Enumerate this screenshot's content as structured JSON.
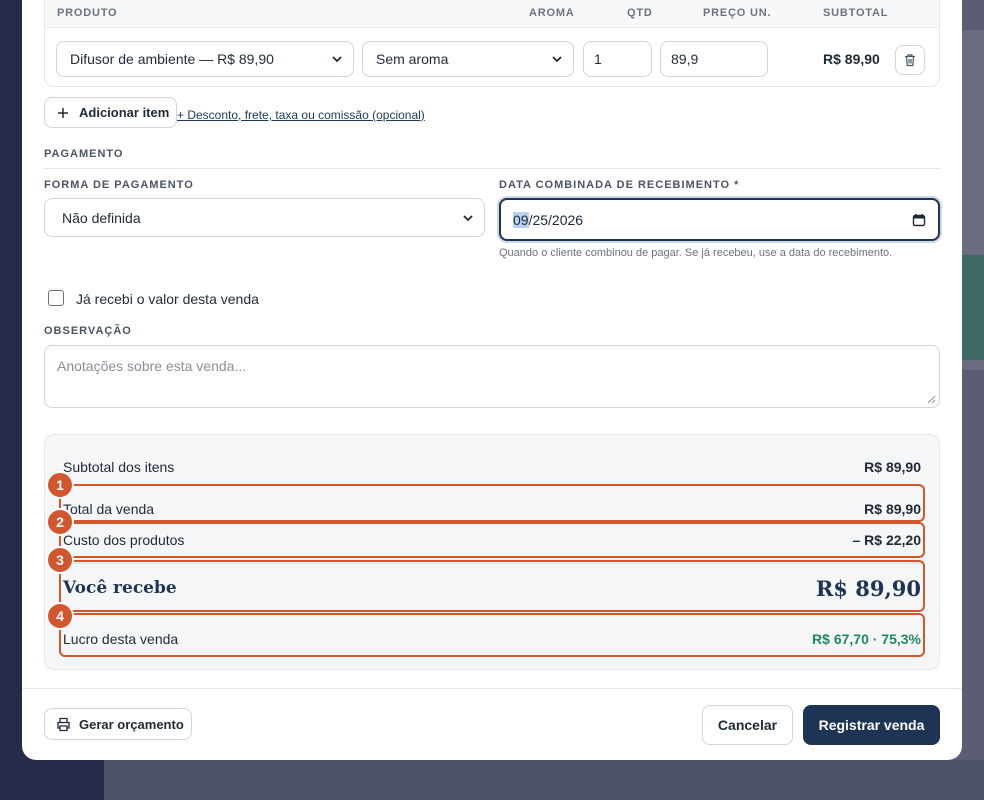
{
  "items_table": {
    "headers": {
      "product": "PRODUTO",
      "aroma": "AROMA",
      "qty": "QTD",
      "unit_price": "PREÇO UN.",
      "subtotal": "SUBTOTAL"
    },
    "row": {
      "product": "Difusor de ambiente — R$ 89,90",
      "aroma": "Sem aroma",
      "qty": "1",
      "unit_price": "89,9",
      "subtotal": "R$ 89,90"
    }
  },
  "actions": {
    "add_item": "Adicionar item",
    "extras_link": "+ Desconto, frete, taxa ou comissão (opcional)"
  },
  "payment": {
    "section": "PAGAMENTO",
    "method_label": "FORMA DE PAGAMENTO",
    "method_value": "Não definida",
    "date_label": "DATA COMBINADA DE RECEBIMENTO *",
    "date_month": "09",
    "date_rest": "/25/2026",
    "date_hint": "Quando o cliente combinou de pagar. Se já recebeu, use a data do recebimento.",
    "received_label": "Já recebi o valor desta venda"
  },
  "note": {
    "label": "OBSERVAÇÃO",
    "placeholder": "Anotações sobre esta venda..."
  },
  "summary": {
    "subtotal_label": "Subtotal dos itens",
    "subtotal_value": "R$ 89,90",
    "total_label": "Total da venda",
    "total_value": "R$ 89,90",
    "cost_label": "Custo dos produtos",
    "cost_value": "– R$ 22,20",
    "receive_label": "Você recebe",
    "receive_value": "R$ 89,90",
    "profit_label": "Lucro desta venda",
    "profit_value": "R$ 67,70 · 75,3%",
    "badges": [
      "1",
      "2",
      "3",
      "4"
    ]
  },
  "footer": {
    "quote": "Gerar orçamento",
    "cancel": "Cancelar",
    "submit": "Registrar venda"
  },
  "colors": {
    "accent": "#d4562e",
    "primary": "#1e3454",
    "profit": "#1f8a5b"
  }
}
